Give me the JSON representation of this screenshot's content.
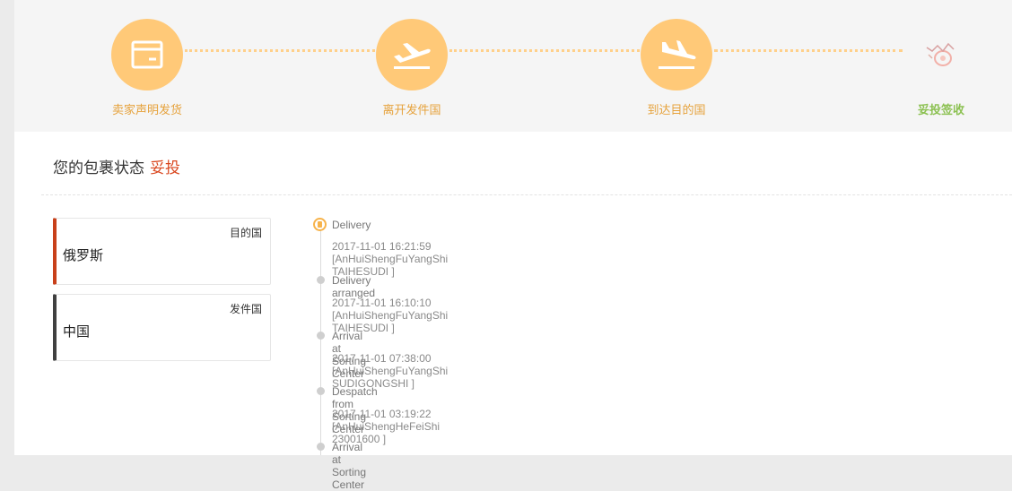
{
  "progress": {
    "steps": [
      {
        "label": "卖家声明发货",
        "icon": "box-icon"
      },
      {
        "label": "离开发件国",
        "icon": "plane-departure-icon"
      },
      {
        "label": "到达目的国",
        "icon": "plane-arrival-icon"
      },
      {
        "label": "妥投签收",
        "icon": "signed-delivery-icon"
      }
    ]
  },
  "status": {
    "label": "您的包裹状态",
    "value": "妥投"
  },
  "countries": {
    "destination": {
      "tag": "目的国",
      "name": "俄罗斯"
    },
    "origin": {
      "tag": "发件国",
      "name": "中国"
    }
  },
  "timeline": [
    {
      "event": "Delivery",
      "detail": "2017-11-01 16:21:59 [AnHuiShengFuYangShi TAIHESUDI ]",
      "current": true
    },
    {
      "event": "Delivery arranged",
      "detail": "2017-11-01 16:10:10 [AnHuiShengFuYangShi TAIHESUDI ]"
    },
    {
      "event": "Arrival at Sorting Center",
      "detail": "2017-11-01 07:38:00 [AnHuiShengFuYangShi SUDIGONGSHI ]"
    },
    {
      "event": "Despatch from Sorting Center",
      "detail": "2017-11-01 03:19:22 [AnHuiShengHeFeiShi 23001600 ]"
    },
    {
      "event": "Arrival at Sorting Center",
      "detail": ""
    }
  ],
  "colors": {
    "step_circle": "#ffc978",
    "step_label": "#e6a23c",
    "final_label": "#8cc152",
    "status_value": "#d9471f",
    "destination_accent": "#c8401a",
    "origin_accent": "#404040"
  }
}
